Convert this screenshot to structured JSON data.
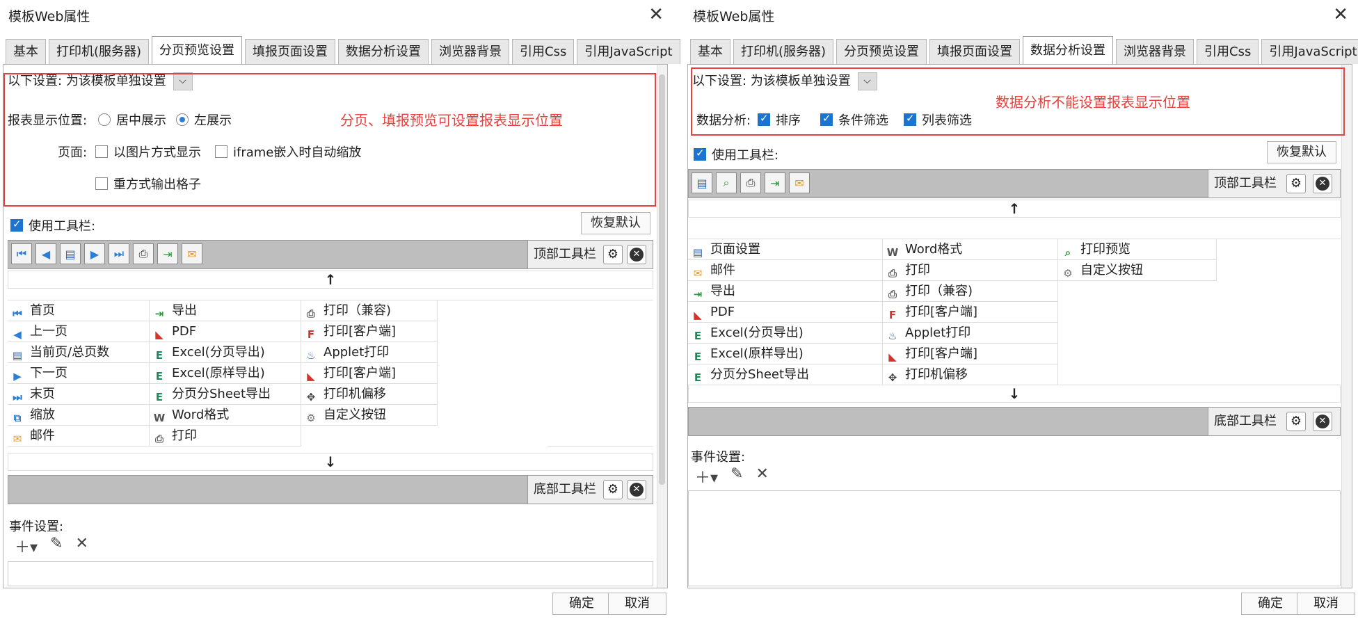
{
  "colors": {
    "annotation": "#e8403f",
    "checkbox": "#1b74d0",
    "toolbar_bg": "#bebebe"
  },
  "left": {
    "title": "模板Web属性",
    "tabs": [
      "基本",
      "打印机(服务器)",
      "分页预览设置",
      "填报页面设置",
      "数据分析设置",
      "浏览器背景",
      "引用Css",
      "引用JavaScript"
    ],
    "active_tab": "分页预览设置",
    "settings_label": "以下设置:",
    "settings_value": "为该模板单独设置",
    "position_label": "报表显示位置:",
    "radio_center": "居中展示",
    "radio_left": "左展示",
    "page_label": "页面:",
    "opt_image": "以图片方式显示",
    "opt_iframe": "iframe嵌入时自动缩放",
    "opt_grid": "重方式输出格子",
    "annotation": "分页、填报预览可设置报表显示位置",
    "use_toolbar": "使用工具栏:",
    "restore": "恢复默认",
    "top_toolbar": "顶部工具栏",
    "bottom_toolbar": "底部工具栏",
    "top_icons": [
      "first-icon",
      "prev-icon",
      "page-icon",
      "next-icon",
      "last-icon",
      "print-icon",
      "export-icon",
      "mail-icon"
    ],
    "items_col1": [
      {
        "icon": "first-icon",
        "label": "首页"
      },
      {
        "icon": "prev-icon",
        "label": "上一页"
      },
      {
        "icon": "page-icon",
        "label": "当前页/总页数"
      },
      {
        "icon": "next-icon",
        "label": "下一页"
      },
      {
        "icon": "last-icon",
        "label": "末页"
      },
      {
        "icon": "zoom-icon",
        "label": "缩放"
      },
      {
        "icon": "mail-icon",
        "label": "邮件"
      }
    ],
    "items_col2": [
      {
        "icon": "export-icon",
        "label": "导出"
      },
      {
        "icon": "pdf-icon",
        "label": "PDF"
      },
      {
        "icon": "excel-icon",
        "label": "Excel(分页导出)"
      },
      {
        "icon": "excel-icon",
        "label": "Excel(原样导出)"
      },
      {
        "icon": "excel-icon",
        "label": "分页分Sheet导出"
      },
      {
        "icon": "word-icon",
        "label": "Word格式"
      },
      {
        "icon": "print-icon",
        "label": "打印"
      }
    ],
    "items_col3": [
      {
        "icon": "print-icon",
        "label": "打印（兼容)"
      },
      {
        "icon": "flash-print-icon",
        "label": "打印[客户端]"
      },
      {
        "icon": "applet-icon",
        "label": "Applet打印"
      },
      {
        "icon": "pdf-print-icon",
        "label": "打印[客户端]"
      },
      {
        "icon": "offset-icon",
        "label": "打印机偏移"
      },
      {
        "icon": "gear-icon",
        "label": "自定义按钮"
      }
    ],
    "events_label": "事件设置:",
    "ok": "确定",
    "cancel": "取消"
  },
  "right": {
    "title": "模板Web属性",
    "tabs": [
      "基本",
      "打印机(服务器)",
      "分页预览设置",
      "填报页面设置",
      "数据分析设置",
      "浏览器背景",
      "引用Css",
      "引用JavaScript"
    ],
    "active_tab": "数据分析设置",
    "settings_label": "以下设置:",
    "settings_value": "为该模板单独设置",
    "annotation": "数据分析不能设置报表显示位置",
    "analysis_label": "数据分析:",
    "opt_sort": "排序",
    "opt_filter": "条件筛选",
    "opt_colfilter": "列表筛选",
    "use_toolbar": "使用工具栏:",
    "restore": "恢复默认",
    "top_toolbar": "顶部工具栏",
    "bottom_toolbar": "底部工具栏",
    "top_icons": [
      "page-setup-icon",
      "print-preview-icon",
      "print-icon",
      "export-icon",
      "mail-icon"
    ],
    "items_col1": [
      {
        "icon": "page-setup-icon",
        "label": "页面设置"
      },
      {
        "icon": "mail-icon",
        "label": "邮件"
      },
      {
        "icon": "export-icon",
        "label": "导出"
      },
      {
        "icon": "pdf-icon",
        "label": "PDF"
      },
      {
        "icon": "excel-icon",
        "label": "Excel(分页导出)"
      },
      {
        "icon": "excel-icon",
        "label": "Excel(原样导出)"
      },
      {
        "icon": "excel-icon",
        "label": "分页分Sheet导出"
      }
    ],
    "items_col2": [
      {
        "icon": "word-icon",
        "label": "Word格式"
      },
      {
        "icon": "print-icon",
        "label": "打印"
      },
      {
        "icon": "print-icon",
        "label": "打印（兼容)"
      },
      {
        "icon": "flash-print-icon",
        "label": "打印[客户端]"
      },
      {
        "icon": "applet-icon",
        "label": "Applet打印"
      },
      {
        "icon": "pdf-print-icon",
        "label": "打印[客户端]"
      },
      {
        "icon": "offset-icon",
        "label": "打印机偏移"
      }
    ],
    "items_col3": [
      {
        "icon": "print-preview-icon",
        "label": "打印预览"
      },
      {
        "icon": "gear-icon",
        "label": "自定义按钮"
      }
    ],
    "events_label": "事件设置:",
    "ok": "确定",
    "cancel": "取消"
  }
}
